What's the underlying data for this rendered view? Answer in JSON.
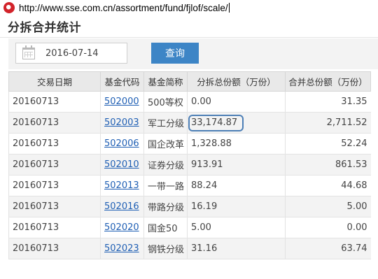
{
  "browser": {
    "url": "http://www.sse.com.cn/assortment/fund/fjlof/scale/"
  },
  "page": {
    "title": "分拆合并统计"
  },
  "query": {
    "date_value": "2016-07-14",
    "button_label": "查询"
  },
  "table": {
    "headers": [
      "交易日期",
      "基金代码",
      "基金简称",
      "分拆总份额（万份）",
      "合并总份额（万份）"
    ],
    "rows": [
      {
        "date": "20160713",
        "code": "502000",
        "name": "500等权",
        "split": "0.00",
        "merge": "31.35"
      },
      {
        "date": "20160713",
        "code": "502003",
        "name": "军工分级",
        "split": "33,174.87",
        "merge": "2,711.52",
        "highlighted": true
      },
      {
        "date": "20160713",
        "code": "502006",
        "name": "国企改革",
        "split": "1,328.88",
        "merge": "52.24"
      },
      {
        "date": "20160713",
        "code": "502010",
        "name": "证券分级",
        "split": "913.91",
        "merge": "861.53"
      },
      {
        "date": "20160713",
        "code": "502013",
        "name": "一带一路",
        "split": "88.24",
        "merge": "44.68"
      },
      {
        "date": "20160713",
        "code": "502016",
        "name": "带路分级",
        "split": "16.19",
        "merge": "5.00"
      },
      {
        "date": "20160713",
        "code": "502020",
        "name": "国金50",
        "split": "5.00",
        "merge": "0.00"
      },
      {
        "date": "20160713",
        "code": "502023",
        "name": "钢铁分级",
        "split": "31.16",
        "merge": "63.74"
      }
    ]
  },
  "colors": {
    "accent_button": "#3d85c6",
    "link": "#1f5fb4",
    "header_bg": "#e9e9e9",
    "alt_row_bg": "#f3f3f3",
    "highlight_ring": "#4d7fb6"
  },
  "icons": {
    "site_logo": "sse-logo-icon",
    "date_picker": "calendar-icon"
  }
}
